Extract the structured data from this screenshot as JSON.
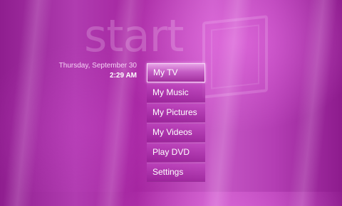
{
  "background_word": "start",
  "clock": {
    "date": "Thursday, September 30",
    "time": "2:29 AM"
  },
  "menu": {
    "items": [
      {
        "label": "My TV",
        "selected": true
      },
      {
        "label": "My Music",
        "selected": false
      },
      {
        "label": "My Pictures",
        "selected": false
      },
      {
        "label": "My Videos",
        "selected": false
      },
      {
        "label": "Play DVD",
        "selected": false
      },
      {
        "label": "Settings",
        "selected": false
      }
    ]
  },
  "colors": {
    "accent": "#b03cb0",
    "highlight": "#e6a0e6"
  }
}
